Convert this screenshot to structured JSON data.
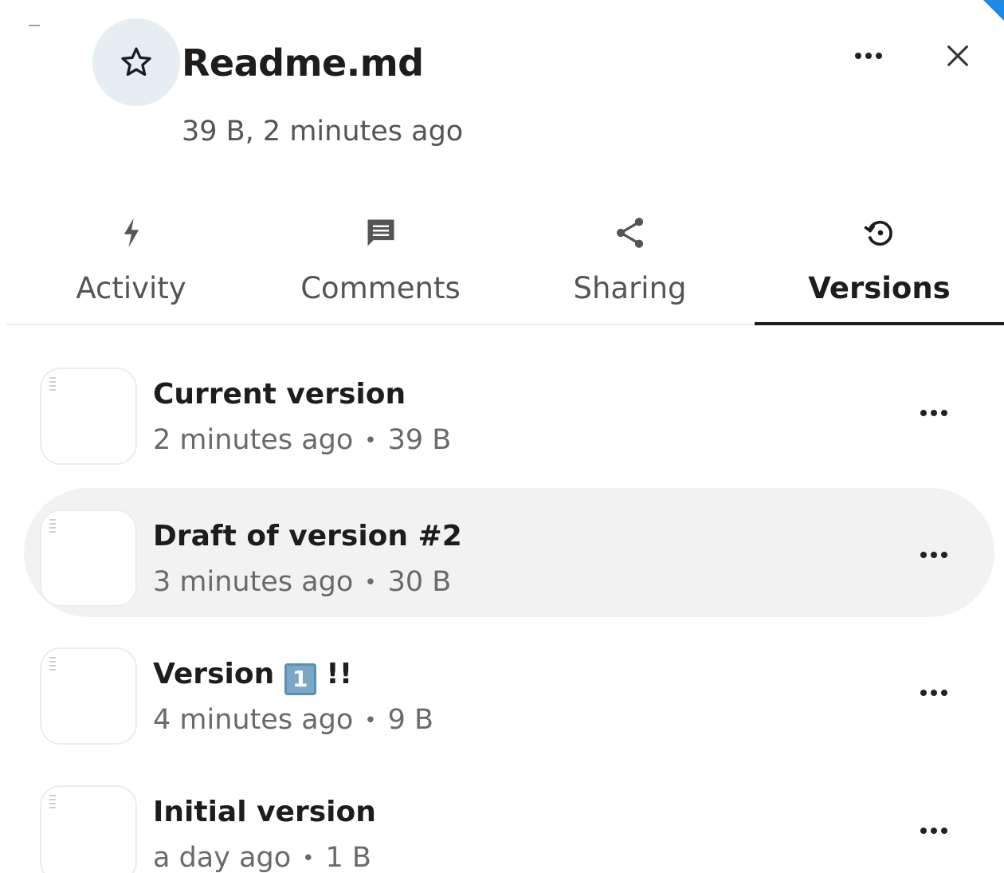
{
  "header": {
    "title": "Readme.md",
    "subtitle": "39 B, 2 minutes ago"
  },
  "tabs": [
    {
      "label": "Activity",
      "icon": "lightning-icon",
      "active": false
    },
    {
      "label": "Comments",
      "icon": "comment-icon",
      "active": false
    },
    {
      "label": "Sharing",
      "icon": "share-icon",
      "active": false
    },
    {
      "label": "Versions",
      "icon": "history-icon",
      "active": true
    }
  ],
  "versions": [
    {
      "title": "Current version",
      "time": "2 minutes ago",
      "size": "39 B"
    },
    {
      "title": "Draft of version #2",
      "time": "3 minutes ago",
      "size": "30 B"
    },
    {
      "title_prefix": "Version",
      "title_emoji": "1",
      "title_suffix": "!!",
      "time": "4 minutes ago",
      "size": "9 B"
    },
    {
      "title": "Initial version",
      "time": "a day ago",
      "size": "1 B"
    }
  ],
  "separator": "•",
  "colors": {
    "star_bg": "#e6eef3",
    "active_tab": "#1d1d1d",
    "row_hover": "#f2f2f2",
    "corner_accent": "#1e88e5"
  }
}
